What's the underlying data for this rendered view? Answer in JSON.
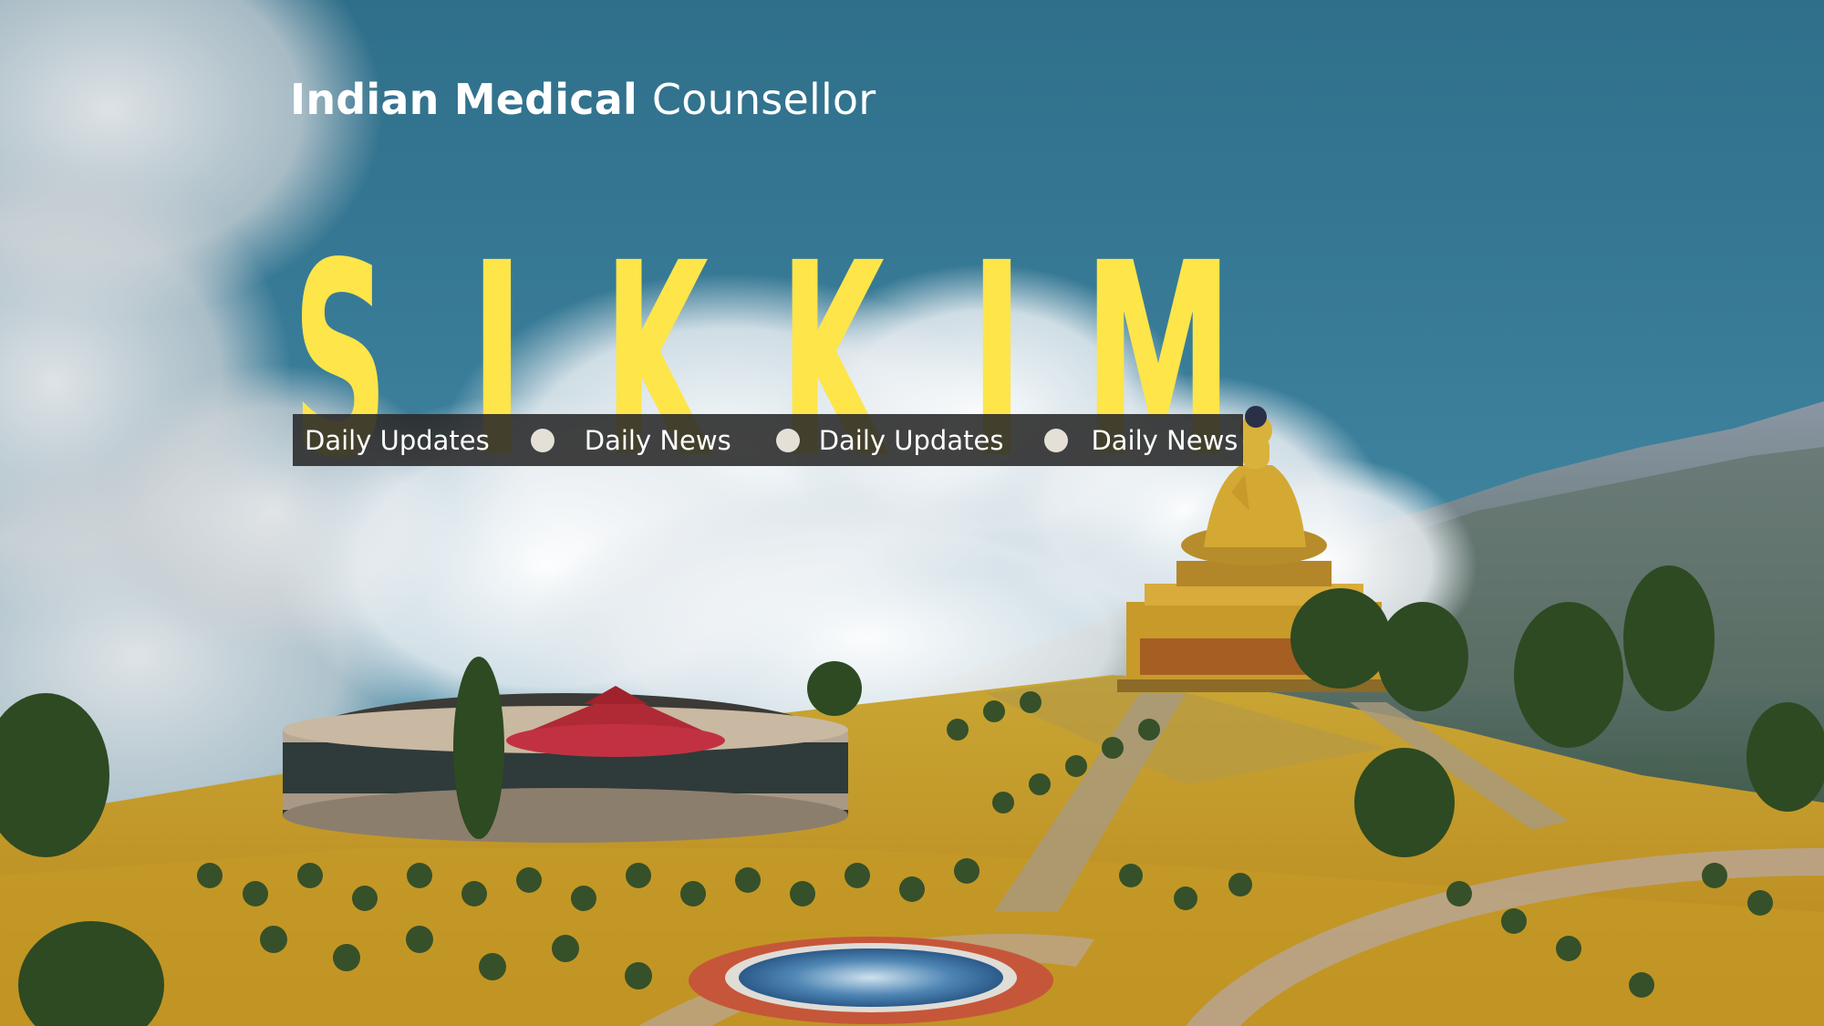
{
  "header": {
    "brand_bold": "Indian Medical",
    "brand_light": "Counsellor"
  },
  "hero": {
    "title_letters": [
      "S",
      "I",
      "K",
      "K",
      "I",
      "M"
    ]
  },
  "ticker": {
    "items": [
      "Daily Updates",
      "Daily News",
      "Daily Updates",
      "Daily News"
    ]
  },
  "colors": {
    "sky": "#3d7c98",
    "title_yellow": "#fde54a",
    "ticker_bg": "#282828",
    "brand_text": "#ffffff"
  }
}
